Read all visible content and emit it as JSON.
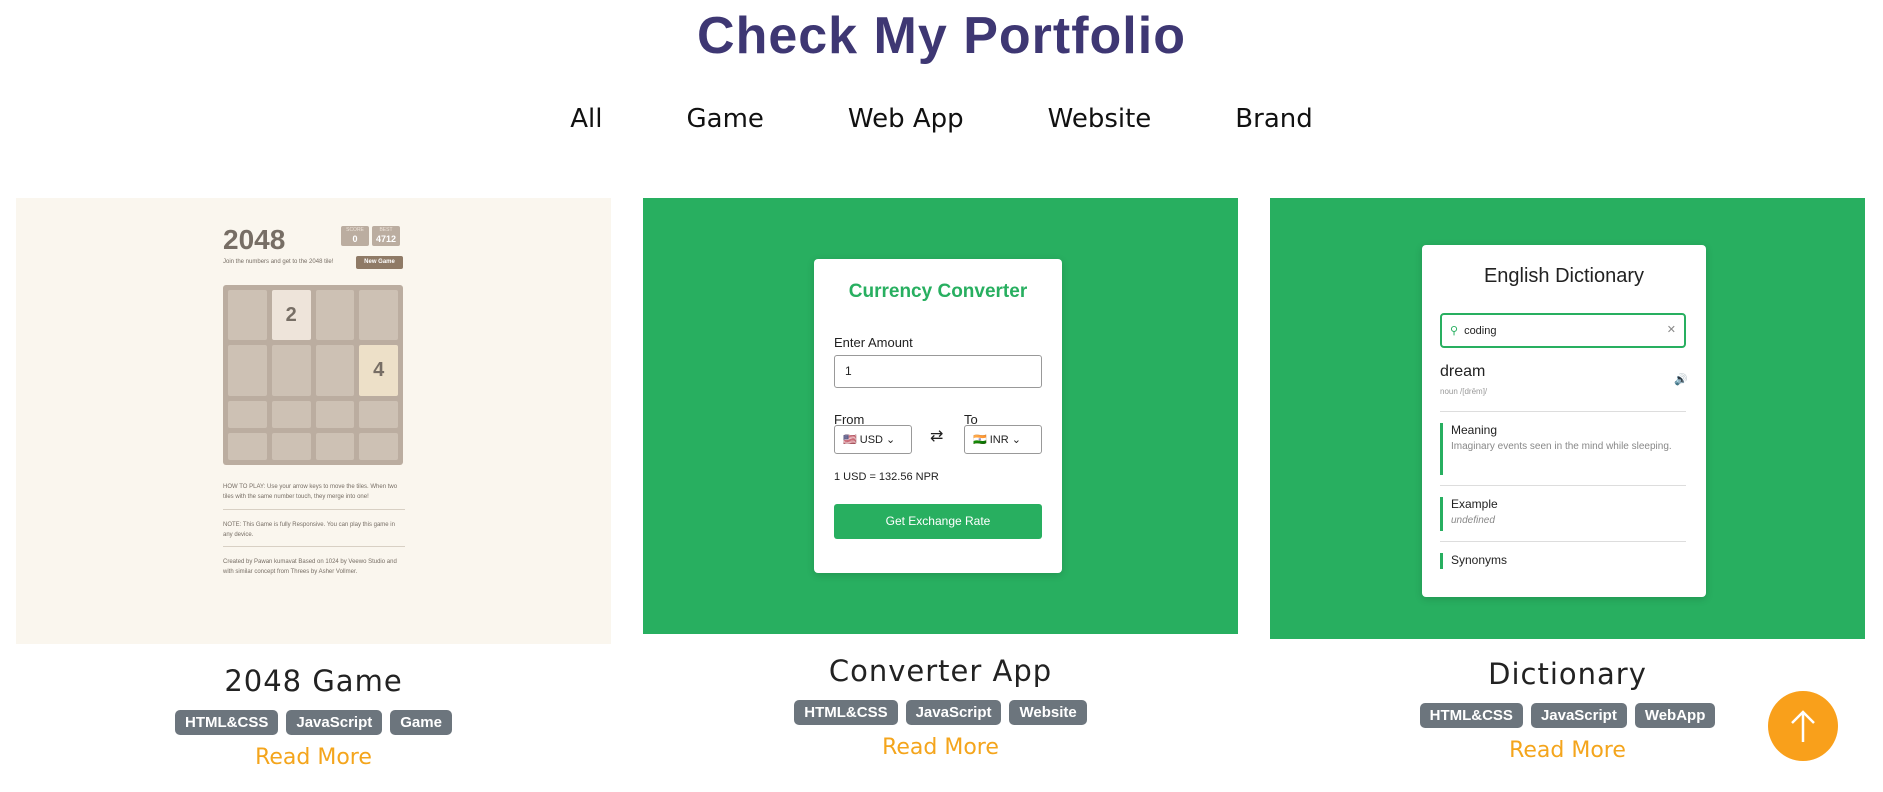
{
  "page": {
    "title": "Check My Portfolio"
  },
  "filters": [
    "All",
    "Game",
    "Web App",
    "Website",
    "Brand"
  ],
  "accent": "#28af60",
  "cards": [
    {
      "title": "2048 Game",
      "tags": [
        "HTML&CSS",
        "JavaScript",
        "Game"
      ],
      "read_more": "Read More",
      "preview": {
        "heading": "2048",
        "score_label": "SCORE",
        "score_value": "0",
        "best_label": "BEST",
        "best_value": "4712",
        "subtitle": "Join the numbers and get to the 2048 tile!",
        "new_game": "New Game",
        "tiles": [
          "",
          "2",
          "",
          "",
          "",
          "",
          "",
          "4",
          "",
          "",
          "",
          "",
          "",
          "",
          "",
          ""
        ],
        "how_to": "HOW TO PLAY: Use your arrow keys to move the tiles. When two tiles with the same number touch, they merge into one!",
        "note": "NOTE: This Game is fully Responsive. You can play this game in any device.",
        "credit": "Created by Pawan kumavat Based on 1024 by Veewo Studio and with similar concept from Threes by Asher Vollmer."
      }
    },
    {
      "title": "Converter App",
      "tags": [
        "HTML&CSS",
        "JavaScript",
        "Website"
      ],
      "read_more": "Read More",
      "preview": {
        "heading": "Currency Converter",
        "amount_label": "Enter Amount",
        "amount_value": "1",
        "from_label": "From",
        "to_label": "To",
        "from_value": "🇺🇸 USD",
        "to_value": "🇮🇳 INR",
        "rate": "1 USD = 132.56 NPR",
        "button": "Get Exchange Rate"
      }
    },
    {
      "title": "Dictionary",
      "tags": [
        "HTML&CSS",
        "JavaScript",
        "WebApp"
      ],
      "read_more": "Read More",
      "preview": {
        "heading": "English Dictionary",
        "search_value": "coding",
        "word": "dream",
        "phonetic": "noun /[drēm]/",
        "meaning_label": "Meaning",
        "meaning_text": "Imaginary events seen in the mind while sleeping.",
        "example_label": "Example",
        "example_text": "undefined",
        "synonyms_label": "Synonyms"
      }
    }
  ]
}
